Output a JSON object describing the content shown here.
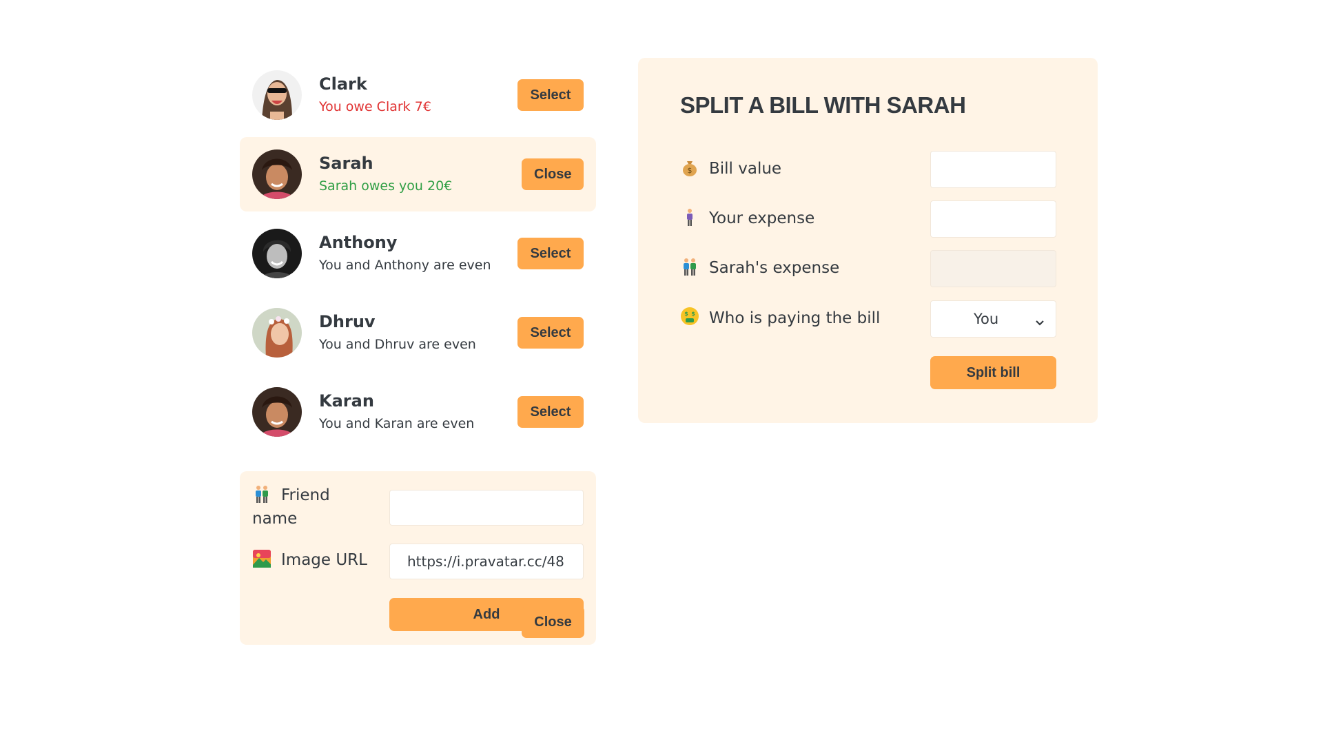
{
  "friends": [
    {
      "name": "Clark",
      "balance": "You owe Clark 7€",
      "button": "Select"
    },
    {
      "name": "Sarah",
      "balance": "Sarah owes you 20€",
      "button": "Close"
    },
    {
      "name": "Anthony",
      "balance": "You and Anthony are even",
      "button": "Select"
    },
    {
      "name": "Dhruv",
      "balance": "You and Dhruv are even",
      "button": "Select"
    },
    {
      "name": "Karan",
      "balance": "You and Karan are even",
      "button": "Select"
    }
  ],
  "add_friend": {
    "name_label": "Friend name",
    "name_label_line1": "Friend",
    "name_label_line2": "name",
    "name_value": "",
    "url_label": "Image URL",
    "url_value": "https://i.pravatar.cc/48",
    "add_button": "Add"
  },
  "sidebar_close_button": "Close",
  "split": {
    "title": "SPLIT A BILL WITH SARAH",
    "bill_label": "Bill value",
    "bill_icon": "money-bag-icon",
    "your_expense_label": "Your expense",
    "your_expense_icon": "person-icon",
    "friend_expense_label": "Sarah's expense",
    "friend_expense_icon": "people-icon",
    "payer_label": "Who is paying the bill",
    "payer_icon": "money-mouth-face-icon",
    "payer_value": "You",
    "submit_button": "Split bill"
  },
  "colors": {
    "accent": "#ffa94d",
    "panel": "#fff4e6",
    "owe": "#e03131",
    "owed": "#2f9e44",
    "text": "#343a40"
  }
}
